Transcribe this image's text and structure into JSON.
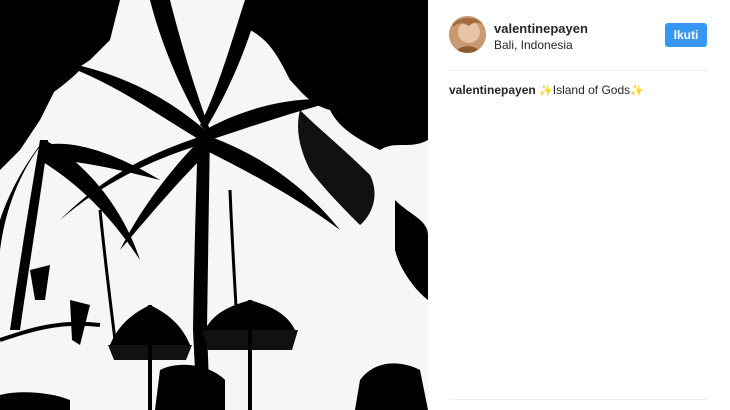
{
  "post": {
    "username": "valentinepayen",
    "location": "Bali, Indonesia",
    "follow_label": "Ikuti"
  },
  "caption": {
    "username": "valentinepayen",
    "sparkle_left": "✨",
    "text": "Island of Gods",
    "sparkle_right": "✨"
  },
  "colors": {
    "follow_button": "#3897f0",
    "text": "#262626",
    "divider": "#efefef"
  },
  "icons": {
    "avatar": "avatar-photo"
  }
}
